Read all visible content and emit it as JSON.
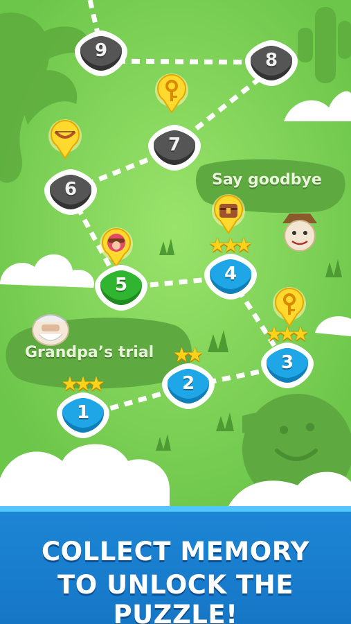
{
  "map": {
    "areas": [
      {
        "label": "Say goodbye"
      },
      {
        "label": "Grandpa’s trial"
      }
    ],
    "levels": [
      {
        "number": "1",
        "state": "completed",
        "stars": 3
      },
      {
        "number": "2",
        "state": "completed",
        "stars": 2
      },
      {
        "number": "3",
        "state": "completed",
        "stars": 3
      },
      {
        "number": "4",
        "state": "completed",
        "stars": 3
      },
      {
        "number": "5",
        "state": "current",
        "stars": 0
      },
      {
        "number": "6",
        "state": "locked",
        "stars": 0
      },
      {
        "number": "7",
        "state": "locked",
        "stars": 0
      },
      {
        "number": "8",
        "state": "locked",
        "stars": 0
      },
      {
        "number": "9",
        "state": "locked",
        "stars": 0
      }
    ],
    "rewards": [
      {
        "icon": "key-icon"
      },
      {
        "icon": "key-icon"
      },
      {
        "icon": "bow-icon"
      },
      {
        "icon": "treasure-chest-icon"
      },
      {
        "icon": "character-avatar-icon"
      }
    ],
    "colors": {
      "completed": "#1ea6e6",
      "current": "#2fb52f",
      "locked": "#555555",
      "star": "#ffd21a"
    }
  },
  "banner": {
    "line1": "COLLECT MEMORY",
    "line2": "TO UNLOCK THE PUZZLE!"
  }
}
